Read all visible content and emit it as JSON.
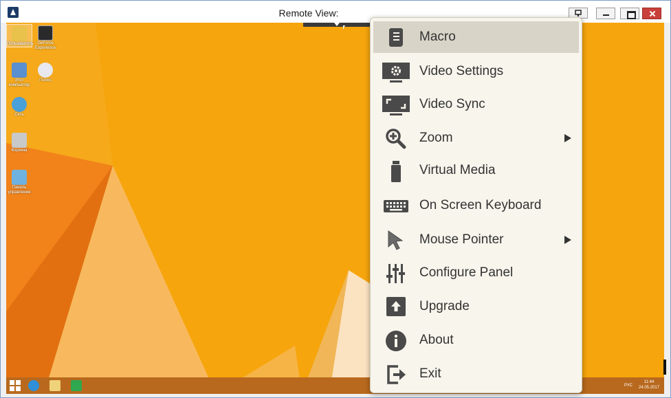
{
  "window": {
    "title": "Remote View:"
  },
  "desktop": {
    "icons": [
      {
        "label": "Пользователь"
      },
      {
        "label": "GeForce Experience"
      },
      {
        "label": "Этот компьютер"
      },
      {
        "label": "iTunes"
      },
      {
        "label": "Сеть"
      },
      {
        "label": "Корзина"
      },
      {
        "label": "Панель управления"
      }
    ]
  },
  "taskbar": {
    "lang": "РУС",
    "time": "11:44",
    "date": "24.05.2017"
  },
  "menu": {
    "items": [
      {
        "label": "Macro",
        "icon": "macro-icon"
      },
      {
        "label": "Video Settings",
        "icon": "video-settings-icon"
      },
      {
        "label": "Video Sync",
        "icon": "video-sync-icon"
      },
      {
        "label": "Zoom",
        "icon": "zoom-icon"
      },
      {
        "label": "Virtual Media",
        "icon": "usb-drive-icon"
      },
      {
        "label": "On Screen Keyboard",
        "icon": "keyboard-icon"
      },
      {
        "label": "Mouse Pointer",
        "icon": "mouse-pointer-icon"
      },
      {
        "label": "Configure Panel",
        "icon": "sliders-icon"
      },
      {
        "label": "Upgrade",
        "icon": "upgrade-icon"
      },
      {
        "label": "About",
        "icon": "info-icon"
      },
      {
        "label": "Exit",
        "icon": "exit-icon"
      }
    ],
    "active_item": "Macro",
    "submenu_items": [
      "Zoom",
      "Mouse Pointer"
    ]
  },
  "colors": {
    "desktop_background": "#f6a50c",
    "menu_background": "#f7f5ec",
    "menu_highlight": "#d8d4c8",
    "menu_icon": "#4a4a4a",
    "close_button": "#c9403a"
  }
}
